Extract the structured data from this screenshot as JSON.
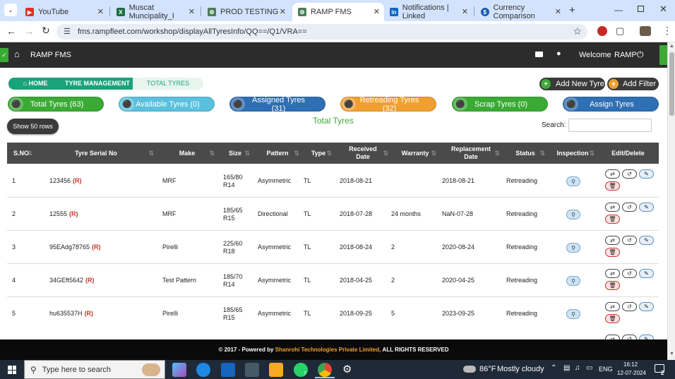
{
  "browser": {
    "tabs": [
      {
        "label": "YouTube",
        "icon": "youtube-icon",
        "color": "#e52d27"
      },
      {
        "label": "Muscat Muncipality_I",
        "icon": "excel-icon",
        "color": "#1d6f42"
      },
      {
        "label": "PROD TESTING",
        "icon": "gear-icon",
        "color": "#4b7d5a"
      },
      {
        "label": "RAMP FMS",
        "icon": "gear-icon",
        "color": "#4b7d5a"
      },
      {
        "label": "Notifications | Linked",
        "icon": "linkedin-icon",
        "color": "#0a66c2"
      },
      {
        "label": "Currency Comparison",
        "icon": "currency-icon",
        "color": "#1a5fb4"
      }
    ],
    "new_tab": "+",
    "url": "fms.rampfleet.com/workshop/displayAllTyresInfo/QQ==/Q1/VRA=="
  },
  "app": {
    "title": "RAMP FMS",
    "welcome": "Welcome",
    "user": "RAMP"
  },
  "breadcrumb": {
    "home": "HOME",
    "tyre_management": "TYRE MANAGEMENT",
    "total_tyres": "TOTAL TYRES"
  },
  "actions": {
    "add_new_tyre": "Add New Tyre",
    "add_filter": "Add Filter",
    "show_rows": "Show 50 rows",
    "search_label": "Search:",
    "search_value": "",
    "page_heading": "Total Tyres"
  },
  "pills": [
    {
      "label": "Total Tyres (63)",
      "color": "#3aaa35"
    },
    {
      "label": "Available Tyres (0)",
      "color": "#5bc0de"
    },
    {
      "label": "Assigned Tyres (31)",
      "color": "#2f6fb3"
    },
    {
      "label": "Retreading Tyres (32)",
      "color": "#f0a030"
    },
    {
      "label": "Scrap Tyres (0)",
      "color": "#3aaa35"
    },
    {
      "label": "Assign Tyres",
      "color": "#2f6fb3"
    }
  ],
  "table": {
    "columns": [
      "S.NO",
      "Tyre Serial No",
      "Make",
      "Size",
      "Pattern",
      "Type",
      "Received Date",
      "Warranty",
      "Replacement Date",
      "Status",
      "Inspection",
      "Edit/Delete"
    ],
    "rows": [
      {
        "sno": "1",
        "serial": "123456",
        "flag": "(R)",
        "make": "MRF",
        "size": "165/80 R14",
        "pattern": "Asymmetric",
        "type": "TL",
        "received": "2018-08-21",
        "warranty": "",
        "replacement": "2018-08-21",
        "status": "Retreading"
      },
      {
        "sno": "2",
        "serial": "12555",
        "flag": "(R)",
        "make": "MRF",
        "size": "185/65 R15",
        "pattern": "Directional",
        "type": "TL",
        "received": "2018-07-28",
        "warranty": "24 months",
        "replacement": "NaN-07-28",
        "status": "Retreading"
      },
      {
        "sno": "3",
        "serial": "95EAdg78765",
        "flag": "(R)",
        "make": "Pirelli",
        "size": "225/60 R18",
        "pattern": "Asymmetric",
        "type": "TL",
        "received": "2018-08-24",
        "warranty": "2",
        "replacement": "2020-08-24",
        "status": "Retreading"
      },
      {
        "sno": "4",
        "serial": "34GEft5642",
        "flag": "(R)",
        "make": "Test Pattern",
        "size": "185/70 R14",
        "pattern": "Asymmetric",
        "type": "TL",
        "received": "2018-04-25",
        "warranty": "2",
        "replacement": "2020-04-25",
        "status": "Retreading"
      },
      {
        "sno": "5",
        "serial": "hu635537H",
        "flag": "(R)",
        "make": "Pirelli",
        "size": "185/65 R15",
        "pattern": "Asymmetric",
        "type": "TL",
        "received": "2018-09-25",
        "warranty": "5",
        "replacement": "2023-09-25",
        "status": "Retreading"
      }
    ]
  },
  "footer": {
    "prefix": "© 2017 - Powered by",
    "company": "Shanrohi Technologies Private Limited,",
    "suffix": "ALL RIGHTS RESERVED"
  },
  "taskbar": {
    "search_placeholder": "Type here to search",
    "weather_temp": "86°F",
    "weather_desc": "Mostly cloudy",
    "lang": "ENG",
    "time": "16:12",
    "date": "12-07-2024",
    "notif_count": "2",
    "whatsapp_badge": "7"
  }
}
